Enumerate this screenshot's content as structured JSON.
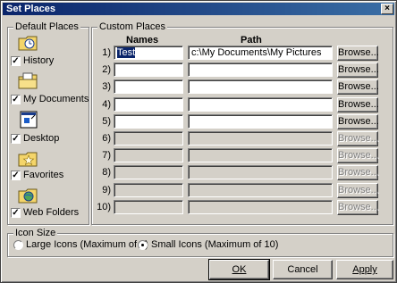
{
  "window": {
    "title": "Set Places",
    "close_glyph": "×"
  },
  "default_places": {
    "legend": "Default Places",
    "items": [
      {
        "label": "History",
        "checked": true,
        "icon": "history-folder-icon"
      },
      {
        "label": "My Documents",
        "checked": true,
        "icon": "my-documents-folder-icon"
      },
      {
        "label": "Desktop",
        "checked": true,
        "icon": "desktop-icon"
      },
      {
        "label": "Favorites",
        "checked": true,
        "icon": "favorites-folder-icon"
      },
      {
        "label": "Web Folders",
        "checked": true,
        "icon": "web-folders-icon"
      }
    ]
  },
  "custom_places": {
    "legend": "Custom Places",
    "col_names": "Names",
    "col_path": "Path",
    "browse_label": "Browse...",
    "rows": [
      {
        "num": "1)",
        "name": "Test",
        "path": "c:\\My Documents\\My Pictures",
        "enabled": true
      },
      {
        "num": "2)",
        "name": "",
        "path": "",
        "enabled": true
      },
      {
        "num": "3)",
        "name": "",
        "path": "",
        "enabled": true
      },
      {
        "num": "4)",
        "name": "",
        "path": "",
        "enabled": true
      },
      {
        "num": "5)",
        "name": "",
        "path": "",
        "enabled": true
      },
      {
        "num": "6)",
        "name": "",
        "path": "",
        "enabled": false
      },
      {
        "num": "7)",
        "name": "",
        "path": "",
        "enabled": false
      },
      {
        "num": "8)",
        "name": "",
        "path": "",
        "enabled": false
      },
      {
        "num": "9)",
        "name": "",
        "path": "",
        "enabled": false
      },
      {
        "num": "10)",
        "name": "",
        "path": "",
        "enabled": false
      }
    ]
  },
  "icon_size": {
    "legend": "Icon Size",
    "options": [
      {
        "label": "Large Icons (Maximum of 5)",
        "selected": false
      },
      {
        "label": "Small Icons (Maximum of 10)",
        "selected": true
      }
    ]
  },
  "buttons": {
    "ok": "OK",
    "cancel": "Cancel",
    "apply": "Apply"
  }
}
